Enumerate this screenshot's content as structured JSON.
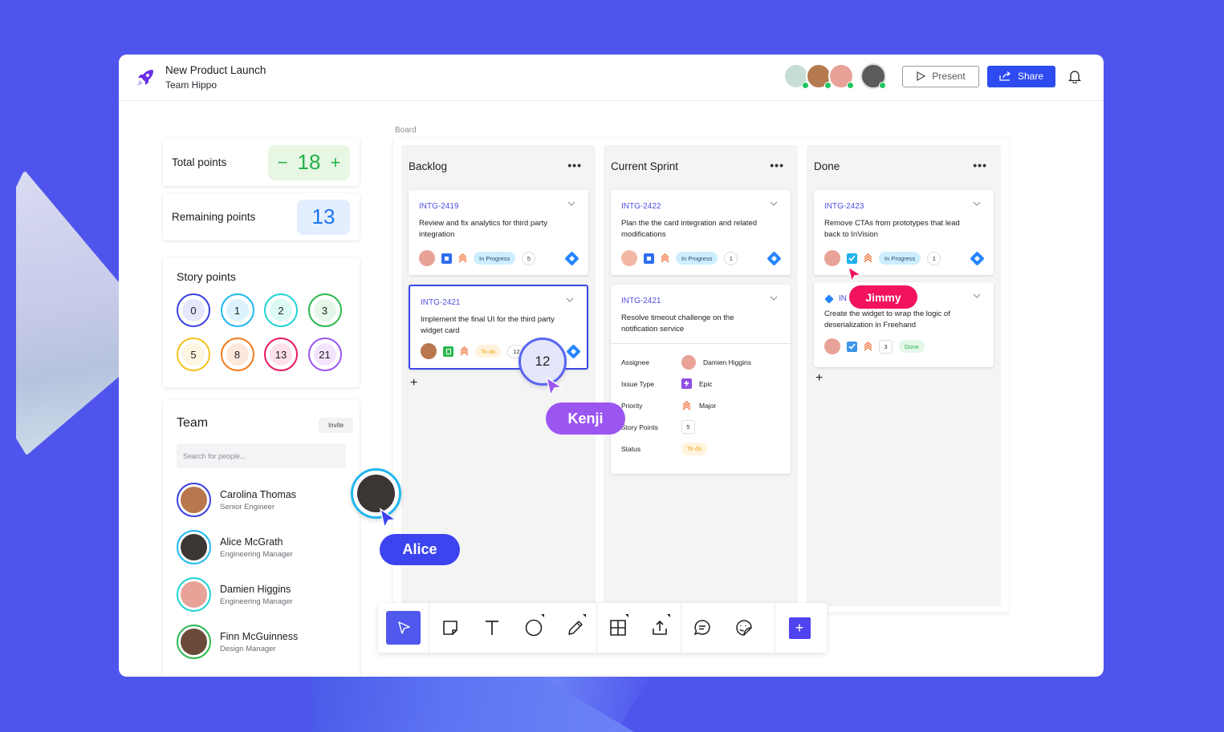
{
  "header": {
    "title": "New Product Launch",
    "subtitle": "Team Hippo",
    "present_label": "Present",
    "share_label": "Share",
    "collaborators": [
      {
        "name": "collaborator-1",
        "color": "#c7ded5",
        "online": true
      },
      {
        "name": "collaborator-2",
        "color": "#b57a4f",
        "online": true
      },
      {
        "name": "collaborator-3",
        "color": "#e8a297",
        "online": true
      },
      {
        "name": "collaborator-4",
        "color": "#5b5b5b",
        "online": true
      }
    ]
  },
  "points": {
    "total_label": "Total points",
    "total_value": "18",
    "decrement": "−",
    "increment": "+",
    "remaining_label": "Remaining points",
    "remaining_value": "13"
  },
  "story_points": {
    "title": "Story points",
    "values": [
      {
        "value": "0",
        "ring": "#3a3fe0",
        "fill": "#e6e7fc"
      },
      {
        "value": "1",
        "ring": "#1fb8f0",
        "fill": "#dcf3fd"
      },
      {
        "value": "2",
        "ring": "#20d3d3",
        "fill": "#dcfaf4"
      },
      {
        "value": "3",
        "ring": "#2bb84e",
        "fill": "#e5f7e9"
      },
      {
        "value": "5",
        "ring": "#f5c21c",
        "fill": "#fdf6e0"
      },
      {
        "value": "8",
        "ring": "#f27a1a",
        "fill": "#fde9dc"
      },
      {
        "value": "13",
        "ring": "#e8185a",
        "fill": "#fde0ea"
      },
      {
        "value": "21",
        "ring": "#9b54f0",
        "fill": "#f3e4fd"
      }
    ]
  },
  "team": {
    "title": "Team",
    "invite_label": "Invite",
    "search_placeholder": "Search for people...",
    "members": [
      {
        "name": "Carolina Thomas",
        "role": "Senior Engineer",
        "ring": "#3a3fe0",
        "color": "#b8774c"
      },
      {
        "name": "Alice McGrath",
        "role": "Engineering Manager",
        "ring": "#1fb8f0",
        "color": "#3b3533"
      },
      {
        "name": "Damien Higgins",
        "role": "Engineering Manager",
        "ring": "#20d3d3",
        "color": "#e8a297"
      },
      {
        "name": "Finn McGuinness",
        "role": "Design Manager",
        "ring": "#2bb84e",
        "color": "#6a4b3a"
      }
    ]
  },
  "board": {
    "label": "Board",
    "columns": [
      {
        "title": "Backlog",
        "more": "•••",
        "cards": [
          {
            "id": "INTG-2419",
            "desc": "Review and fix analytics for third party integration",
            "status": "In Progress",
            "count": "5"
          },
          {
            "id": "INTG-2421",
            "desc": "Implement the final UI for the third party widget card",
            "status": "To do",
            "count": "12"
          }
        ]
      },
      {
        "title": "Current Sprint",
        "more": "•••",
        "cards": [
          {
            "id": "INTG-2422",
            "desc": "Plan the the card integration and related modifications",
            "status": "In Progress",
            "count": "1"
          },
          {
            "id": "INTG-2421",
            "desc": "Resolve timeout challenge on the notification service",
            "details": {
              "assignee_label": "Assignee",
              "assignee": "Damien Higgins",
              "type_label": "Issue Type",
              "type": "Epic",
              "priority_label": "Priority",
              "priority": "Major",
              "points_label": "Story Points",
              "points": "5",
              "status_label": "Status",
              "status": "To do"
            }
          }
        ]
      },
      {
        "title": "Done",
        "more": "•••",
        "cards": [
          {
            "id": "INTG-2423",
            "desc": "Remove CTAs from prototypes that lead back to InVision",
            "status": "In Progress",
            "count": "1"
          },
          {
            "id": "INTG-2424",
            "id_visible": "IN",
            "desc": "Create the widget to wrap the logic of deserialization in Freehand",
            "status": "Done",
            "count": "3"
          }
        ]
      }
    ],
    "add_label": "+"
  },
  "toolbar": {
    "tools": [
      "select-tool",
      "sticky-note-tool",
      "text-tool",
      "shape-tool",
      "pen-tool",
      "table-tool",
      "upload-tool",
      "comment-tool",
      "sticker-tool",
      "add-tool"
    ],
    "add_label": "+"
  },
  "cursors": [
    {
      "name": "Kenji",
      "color": "#9b55f0",
      "value_bubble": "12"
    },
    {
      "name": "Alice",
      "color": "#3b44ef"
    },
    {
      "name": "Jimmy",
      "color": "#f2125d"
    }
  ],
  "colors": {
    "background": "#4f55ec",
    "accent": "#2d4bf0",
    "link": "#4e4fdf"
  }
}
